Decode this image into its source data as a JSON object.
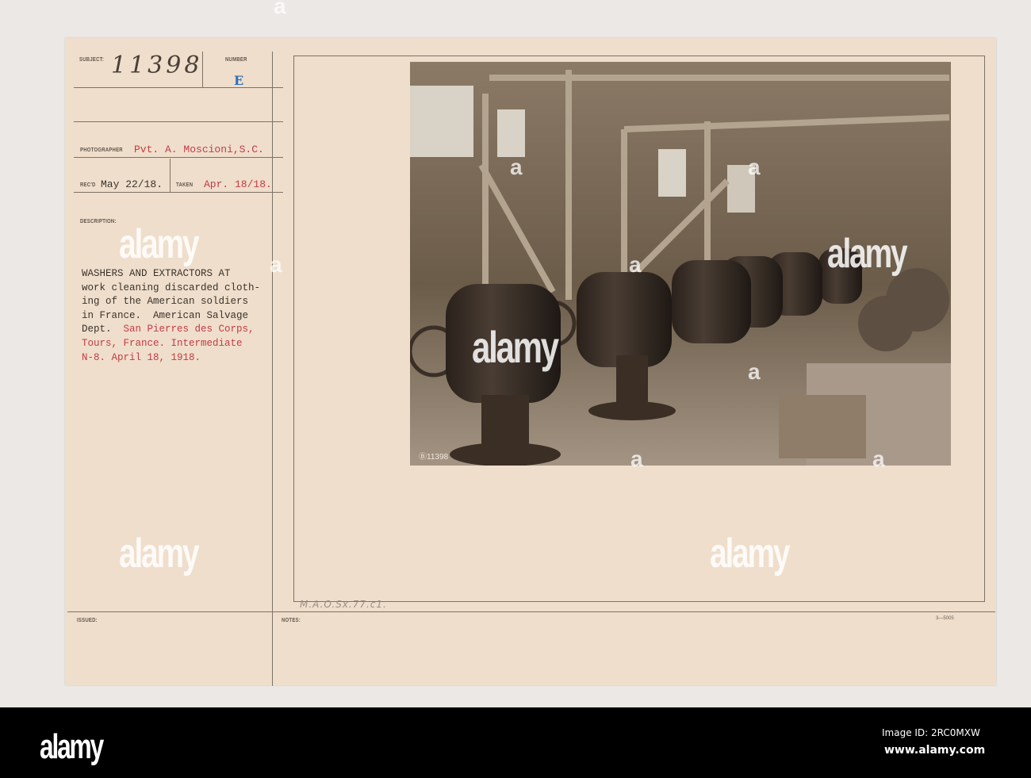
{
  "card": {
    "labels": {
      "subject": "SUBJECT:",
      "number": "NUMBER",
      "photographer": "PHOTOGRAPHER",
      "recd": "REC'D",
      "taken": "TAKEN",
      "description": "DESCRIPTION:",
      "issued": "ISSUED:",
      "notes": "NOTES:"
    },
    "subject_number": "11398",
    "number_letter": "E",
    "photographer": "Pvt. A. Moscioni,S.C.",
    "recd": "May 22/18.",
    "taken": "Apr. 18/18.",
    "description_black": "WASHERS AND EXTRACTORS AT\nwork cleaning discarded cloth-\ning of the American soldiers\nin France.  American Salvage\nDept.  ",
    "description_red_1": "San Pierres des Corps,",
    "description_red_2": "Tours, France. Intermediate\nN-8. April 18, 1918.",
    "pencil_note": "M.A.O.Sx.77.c1.",
    "form_number": "3—5005"
  },
  "photo": {
    "negative_number": "Ⓑ11398"
  },
  "watermark": {
    "logo": "alamy",
    "small_mark": "a"
  },
  "footer": {
    "logo": "alamy",
    "image_id": "Image ID: 2RC0MXW",
    "site": "www.alamy.com"
  }
}
